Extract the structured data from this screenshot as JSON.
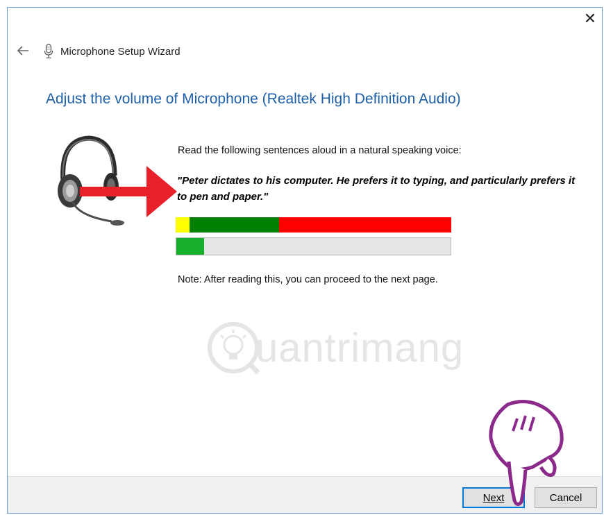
{
  "window": {
    "title": "Microphone Setup Wizard",
    "close_glyph": "✕",
    "back_glyph": "←"
  },
  "heading": "Adjust the volume of Microphone (Realtek High Definition Audio)",
  "instruction": "Read the following sentences aloud in a natural speaking voice:",
  "quote": "\"Peter dictates to his computer. He prefers it to typing, and particularly prefers it to pen and paper.\"",
  "volume_meter": {
    "segments": [
      {
        "color": "#ffff00",
        "fraction": 0.05
      },
      {
        "color": "#008000",
        "fraction": 0.325
      },
      {
        "color": "#ff0000",
        "fraction": 0.625
      }
    ]
  },
  "input_level": {
    "fraction": 0.1,
    "color": "#17b02d"
  },
  "note": "Note: After reading this, you can proceed to the next page.",
  "watermark": {
    "text": "uantrimang"
  },
  "footer": {
    "next_label": "Next",
    "cancel_label": "Cancel"
  },
  "icons": [
    "microphone-icon",
    "headset-icon",
    "red-arrow-icon",
    "pointing-hand-icon",
    "lightbulb-logo-icon"
  ],
  "colors": {
    "heading": "#1f5fa8",
    "arrow": "#e8202a",
    "hand": "#8b2a8b",
    "focus_border": "#0078d7"
  }
}
